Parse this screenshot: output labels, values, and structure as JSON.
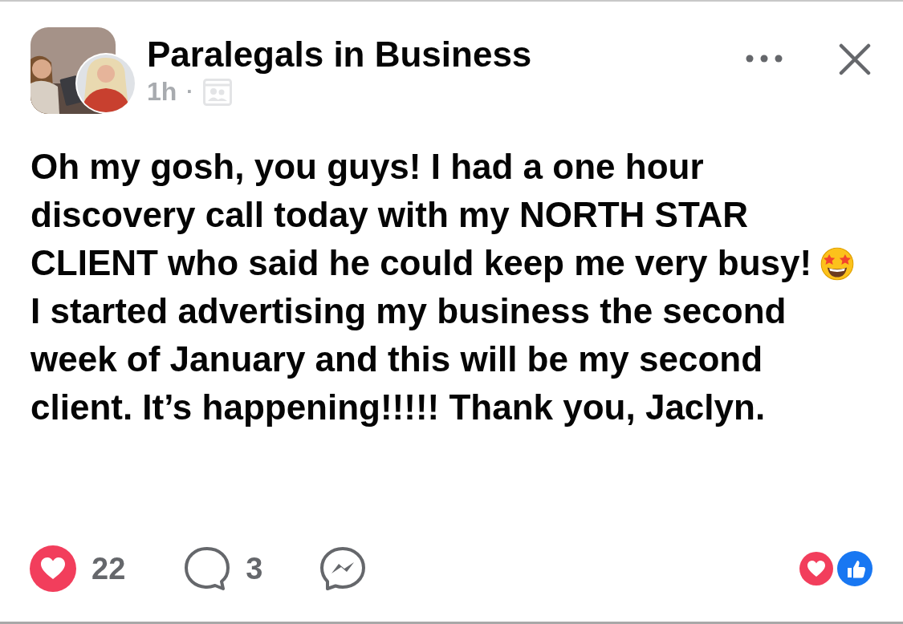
{
  "post": {
    "group_name": "Paralegals in Business",
    "time": "1h",
    "separator": "·",
    "paragraphs": [
      {
        "text": "Oh my gosh, you guys! I had a one hour discovery call today with my NORTH STAR CLIENT who said he could keep me very busy!",
        "trailing_emoji": true
      },
      {
        "text": "I started advertising my business the second week of January and this will be my second client. It’s happening!!!!! Thank you, Jaclyn.",
        "trailing_emoji": false
      }
    ],
    "reactions_count": "22",
    "comments_count": "3"
  }
}
